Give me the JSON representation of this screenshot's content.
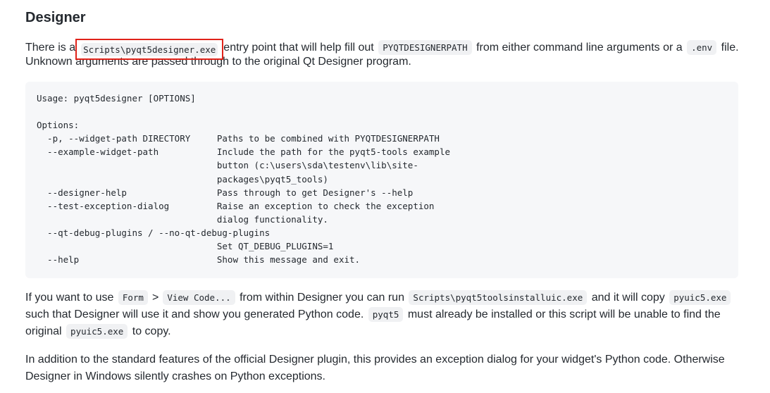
{
  "heading": "Designer",
  "para1": {
    "line1_text1": "There is a",
    "line1_code1": "Scripts\\pyqt5designer.exe",
    "line1_text2": "entry point that will help fill out",
    "line1_code2": "PYQTDESIGNERPATH",
    "line1_text3": "from either command line arguments or a",
    "line1_code3": ".env",
    "line1_text4": "file.",
    "line2_text": "Unknown arguments are passed through to the original Qt Designer program."
  },
  "usage_block": [
    "Usage: pyqt5designer [OPTIONS]",
    "",
    "Options:",
    "  -p, --widget-path DIRECTORY     Paths to be combined with PYQTDESIGNERPATH",
    "  --example-widget-path           Include the path for the pyqt5-tools example",
    "                                  button (c:\\users\\sda\\testenv\\lib\\site-",
    "                                  packages\\pyqt5_tools)",
    "  --designer-help                 Pass through to get Designer's --help",
    "  --test-exception-dialog         Raise an exception to check the exception",
    "                                  dialog functionality.",
    "  --qt-debug-plugins / --no-qt-debug-plugins",
    "                                  Set QT_DEBUG_PLUGINS=1",
    "  --help                          Show this message and exit."
  ],
  "para2": {
    "line1_text1": "If you want to use",
    "line1_code1": "Form",
    "line1_sep": ">",
    "line1_code2": "View Code...",
    "line1_text2": "from within Designer you can run",
    "line1_code3": "Scripts\\pyqt5toolsinstalluic.exe",
    "line1_text3": "and it will copy",
    "line1_code4": "pyuic5.exe",
    "line2_text1": "such that Designer will use it and show you generated Python code.",
    "line2_code1": "pyqt5",
    "line2_text2": "must already be installed or this script will be unable to find the",
    "line3_text1": "original",
    "line3_code1": "pyuic5.exe",
    "line3_text2": "to copy."
  },
  "para3": {
    "line1": "In addition to the standard features of the official Designer plugin, this provides an exception dialog for your widget's Python code. Otherwise",
    "line2": "Designer in Windows silently crashes on Python exceptions."
  },
  "colors": {
    "highlight_border": "#e0231a",
    "code_background": "#f0f1f3",
    "block_background": "#f6f7f9",
    "text": "#24292f"
  }
}
